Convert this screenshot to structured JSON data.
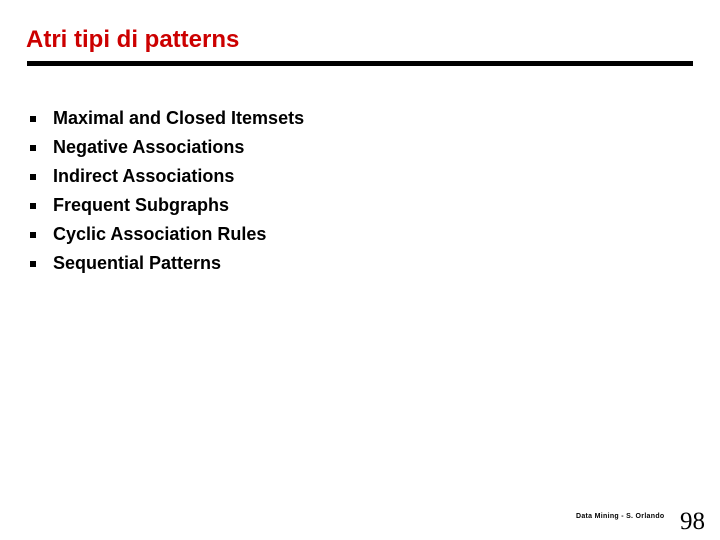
{
  "slide": {
    "title": "Atri tipi di patterns",
    "title_color": "#cc0000",
    "rule_color": "#000000",
    "background_color": "#ffffff",
    "bullets": [
      {
        "marker": "square-bullet",
        "label": "Maximal and Closed Itemsets"
      },
      {
        "marker": "square-bullet",
        "label": "Negative Associations"
      },
      {
        "marker": "square-bullet",
        "label": "Indirect Associations"
      },
      {
        "marker": "square-bullet",
        "label": "Frequent Subgraphs"
      },
      {
        "marker": "square-bullet",
        "label": "Cyclic Association Rules"
      },
      {
        "marker": "square-bullet",
        "label": "Sequential Patterns"
      }
    ],
    "footer": {
      "credit": "Data Mining - S. Orlando",
      "page_number": "98"
    }
  }
}
